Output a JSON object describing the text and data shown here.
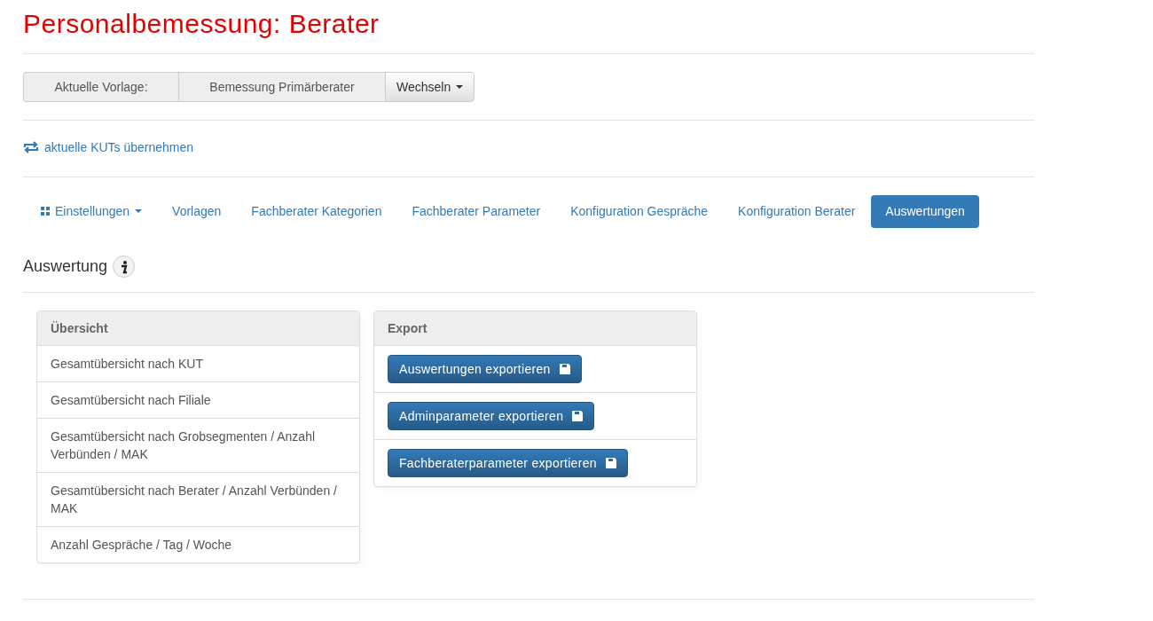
{
  "title": "Personalbemessung: Berater",
  "template_bar": {
    "label": "Aktuelle Vorlage:",
    "value": "Bemessung Primärberater",
    "button": "Wechseln"
  },
  "sync_link": "aktuelle KUTs übernehmen",
  "tabs": [
    {
      "label": "Einstellungen",
      "kind": "dropdown",
      "selected": false
    },
    {
      "label": "Vorlagen",
      "kind": "link",
      "selected": false
    },
    {
      "label": "Fachberater Kategorien",
      "kind": "link",
      "selected": false
    },
    {
      "label": "Fachberater Parameter",
      "kind": "link",
      "selected": false
    },
    {
      "label": "Konfiguration Gespräche",
      "kind": "link",
      "selected": false
    },
    {
      "label": "Konfiguration Berater",
      "kind": "link",
      "selected": false
    },
    {
      "label": "Auswertungen",
      "kind": "link",
      "selected": true
    }
  ],
  "section_title": "Auswertung",
  "overview_panel": {
    "heading": "Übersicht",
    "items": [
      "Gesamtübersicht nach KUT",
      "Gesamtübersicht nach Filiale",
      "Gesamtübersicht nach Grobsegmenten / Anzahl Verbünden / MAK",
      "Gesamtübersicht nach Berater / Anzahl Verbünden / MAK",
      "Anzahl Gespräche / Tag / Woche"
    ]
  },
  "export_panel": {
    "heading": "Export",
    "buttons": [
      "Auswertungen exportieren",
      "Adminparameter exportieren",
      "Fachberaterparameter exportieren"
    ]
  }
}
